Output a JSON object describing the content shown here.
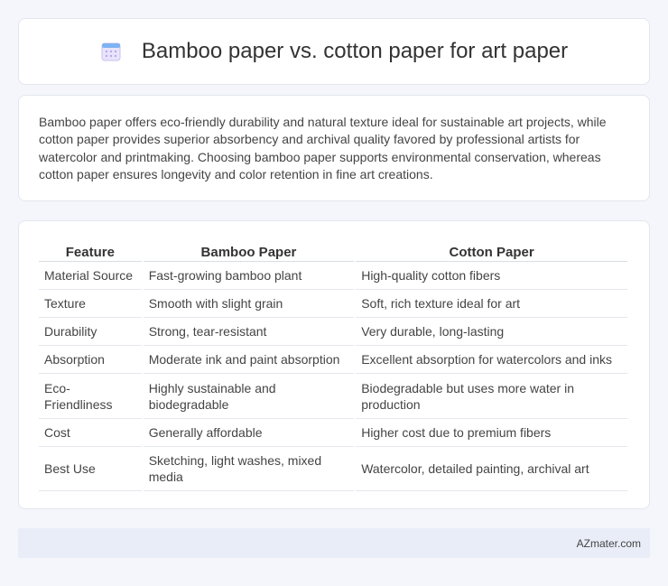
{
  "header": {
    "title": "Bamboo paper vs. cotton paper for art paper",
    "icon": "calendar-icon"
  },
  "summary": {
    "text": "Bamboo paper offers eco-friendly durability and natural texture ideal for sustainable art projects, while cotton paper provides superior absorbency and archival quality favored by professional artists for watercolor and printmaking. Choosing bamboo paper supports environmental conservation, whereas cotton paper ensures longevity and color retention in fine art creations."
  },
  "table": {
    "headers": [
      "Feature",
      "Bamboo Paper",
      "Cotton Paper"
    ],
    "rows": [
      [
        "Material Source",
        "Fast-growing bamboo plant",
        "High-quality cotton fibers"
      ],
      [
        "Texture",
        "Smooth with slight grain",
        "Soft, rich texture ideal for art"
      ],
      [
        "Durability",
        "Strong, tear-resistant",
        "Very durable, long-lasting"
      ],
      [
        "Absorption",
        "Moderate ink and paint absorption",
        "Excellent absorption for watercolors and inks"
      ],
      [
        "Eco-Friendliness",
        "Highly sustainable and biodegradable",
        "Biodegradable but uses more water in production"
      ],
      [
        "Cost",
        "Generally affordable",
        "Higher cost due to premium fibers"
      ],
      [
        "Best Use",
        "Sketching, light washes, mixed media",
        "Watercolor, detailed painting, archival art"
      ]
    ]
  },
  "footer": {
    "text": "AZmater.com"
  }
}
